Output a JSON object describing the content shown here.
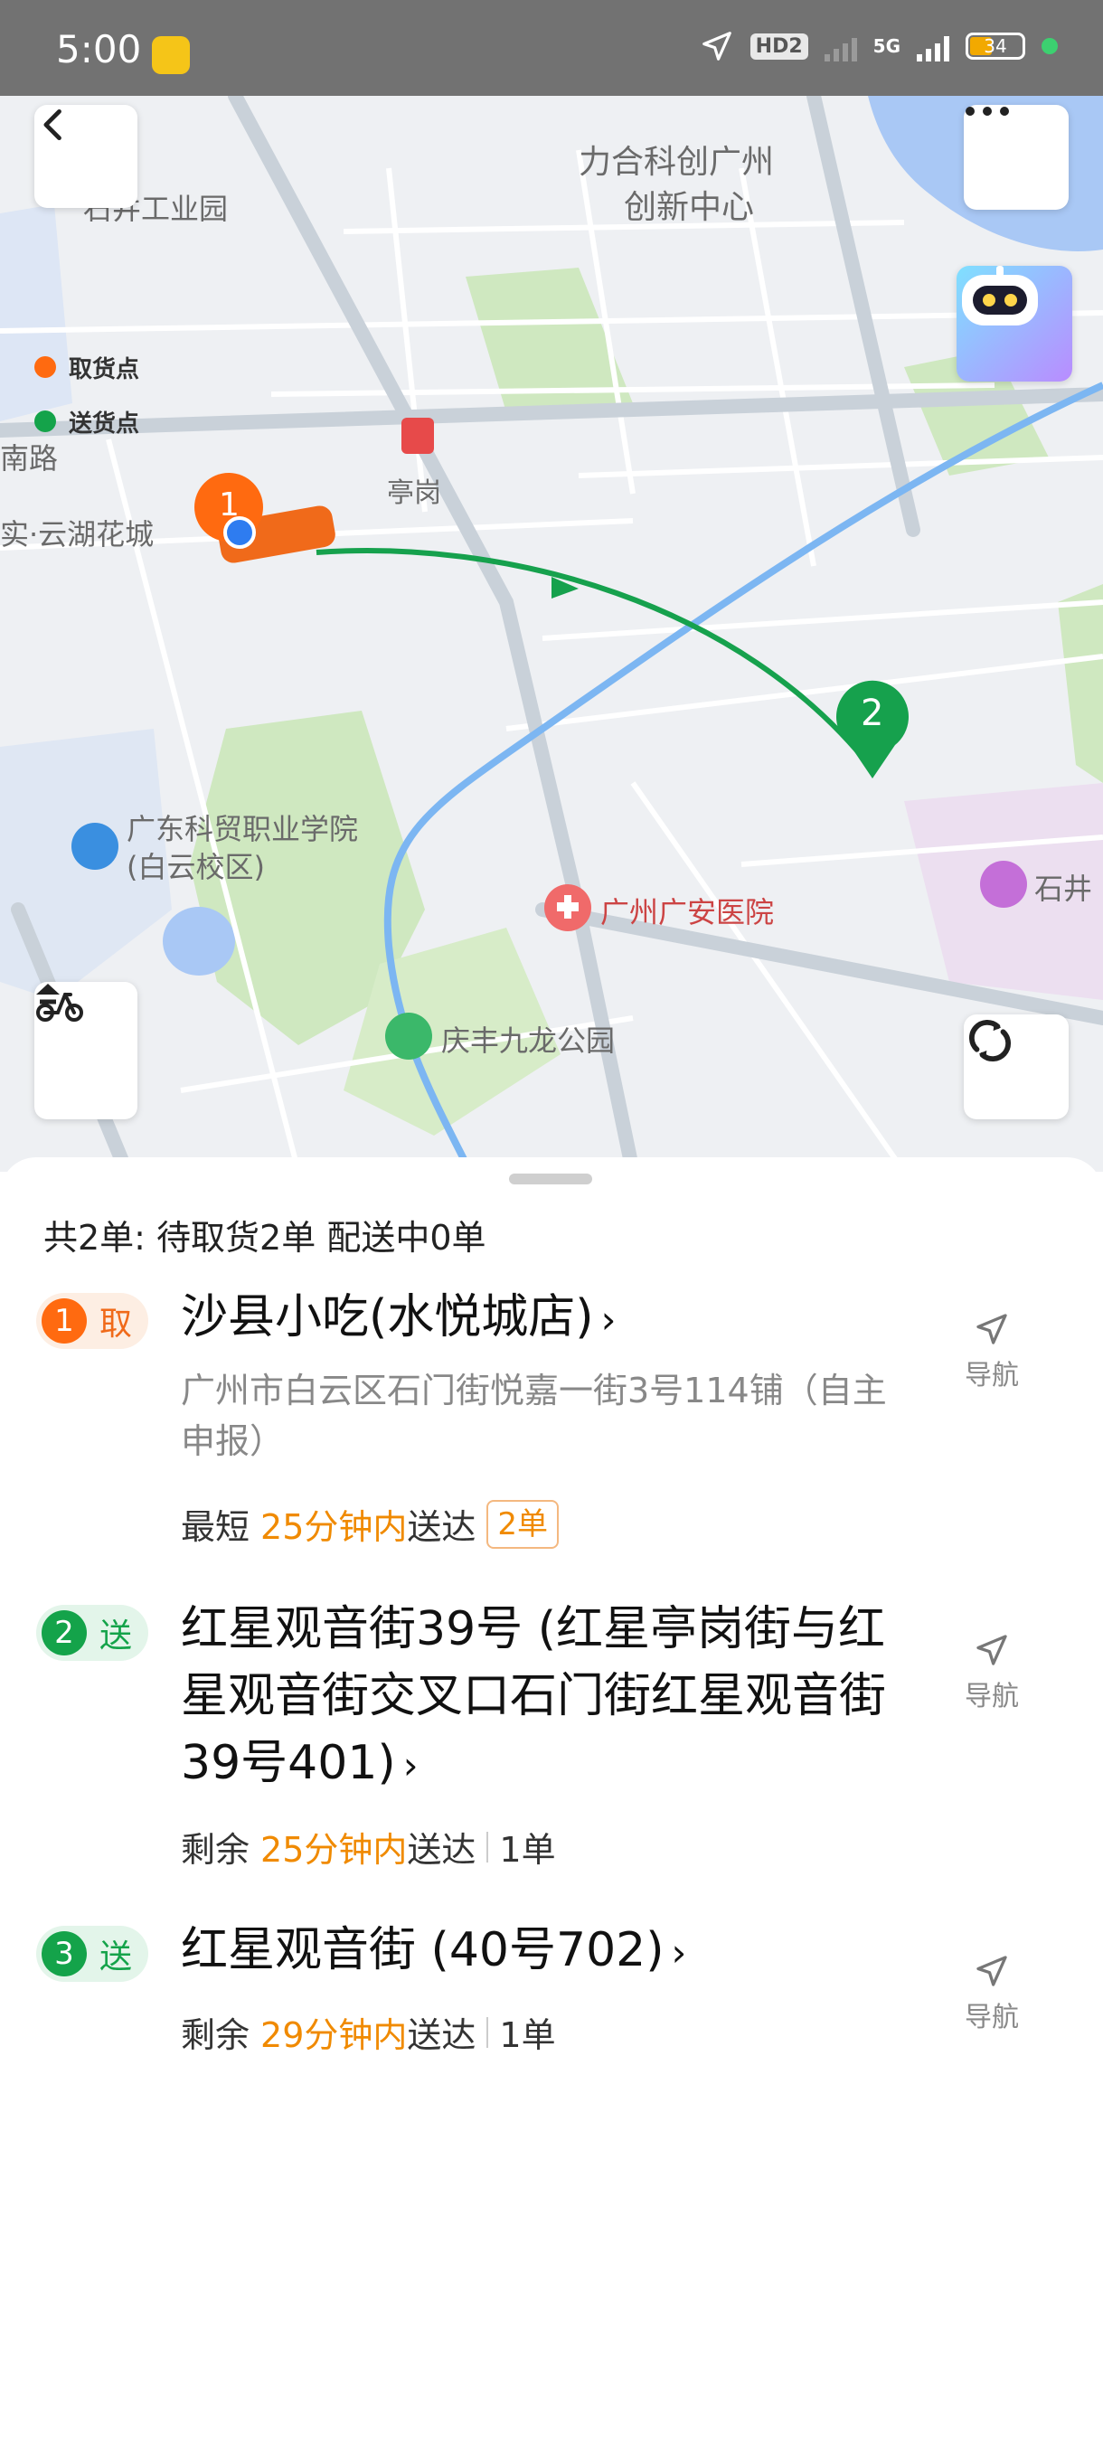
{
  "status_bar": {
    "time": "5:00",
    "network_badge": "HD2",
    "net_type": "5G",
    "battery": "34"
  },
  "map": {
    "labels": {
      "area1": "石井工业园",
      "area2_line1": "力合科创广州",
      "area2_line2": "创新中心",
      "road": "南路",
      "estate": "实·云湖花城",
      "metro": "亭岗",
      "college_line1": "广东科贸职业学院",
      "college_line2": "(白云校区)",
      "hospital": "广州广安医院",
      "park": "庆丰九龙公园",
      "town": "石井"
    },
    "legend": {
      "pickup": "取货点",
      "delivery": "送货点"
    },
    "markers": {
      "pickup_number": "1",
      "drop_number": "2"
    }
  },
  "sheet": {
    "summary": "共2单: 待取货2单 配送中0单",
    "nav_label": "导航",
    "orders": [
      {
        "number": "1",
        "type_label": "取",
        "title": "沙县小吃(水悦城店)",
        "address": "广州市白云区石门街悦嘉一街3号114铺（自主申报）",
        "meta_prefix": "最短",
        "meta_time": "25分钟内",
        "meta_suffix": "送达",
        "meta_count": "2单"
      },
      {
        "number": "2",
        "type_label": "送",
        "title": "红星观音街39号 (红星亭岗街与红星观音街交叉口石门街红星观音街39号401)",
        "meta_prefix": "剩余",
        "meta_time": "25分钟内",
        "meta_suffix": "送达",
        "meta_count": "1单"
      },
      {
        "number": "3",
        "type_label": "送",
        "title": "红星观音街 (40号702)",
        "meta_prefix": "剩余",
        "meta_time": "29分钟内",
        "meta_suffix": "送达",
        "meta_count": "1单"
      }
    ]
  },
  "colors": {
    "pickup": "#ff6a10",
    "delivery": "#14a34a",
    "highlight": "#f08a00"
  }
}
